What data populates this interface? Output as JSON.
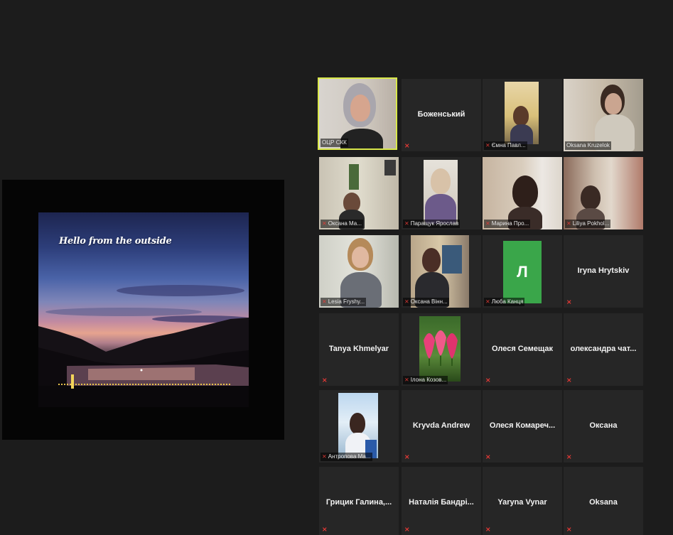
{
  "share": {
    "slide_title": "Hello from the outside"
  },
  "participants": [
    {
      "name": "ОЦР СКК",
      "video": true
    },
    {
      "name": "Боженський",
      "video": false
    },
    {
      "name": "Ємна Павл...",
      "video": true
    },
    {
      "name": "Oksana Kruzelok",
      "video": true
    },
    {
      "name": "Оксана Ма...",
      "video": true
    },
    {
      "name": "Паращук Ярослав",
      "video": true
    },
    {
      "name": "Марина Про...",
      "video": true
    },
    {
      "name": "Liliya Pokhol...",
      "video": true
    },
    {
      "name": "Lesia Fryshy...",
      "video": true
    },
    {
      "name": "Оксана Вінн...",
      "video": true
    },
    {
      "name": "Люба Канця",
      "video": false,
      "avatar_letter": "Л"
    },
    {
      "name": "Iryna Hrytskiv",
      "video": false
    },
    {
      "name": "Tanya Khmelyar",
      "video": false
    },
    {
      "name": "Ілона Козов...",
      "video": true
    },
    {
      "name": "Олеся Семещак",
      "video": false
    },
    {
      "name": "олександра чат...",
      "video": false
    },
    {
      "name": "Антропова Ма...",
      "video": true
    },
    {
      "name": "Kryvda Andrew",
      "video": false
    },
    {
      "name": "Олеся Комареч...",
      "video": false
    },
    {
      "name": "Оксана",
      "video": false
    },
    {
      "name": "Грицик Галина,...",
      "video": false
    },
    {
      "name": "Наталія Бандрі...",
      "video": false
    },
    {
      "name": "Yaryna Vynar",
      "video": false
    },
    {
      "name": "Oksana",
      "video": false
    }
  ],
  "colors": {
    "background": "#1c1c1c",
    "tile": "#262626",
    "active_speaker_border": "#d9e84a",
    "muted_icon": "#e53935",
    "avatar_green": "#3aa64a"
  },
  "icons": {
    "muted": "mic-muted-icon"
  }
}
